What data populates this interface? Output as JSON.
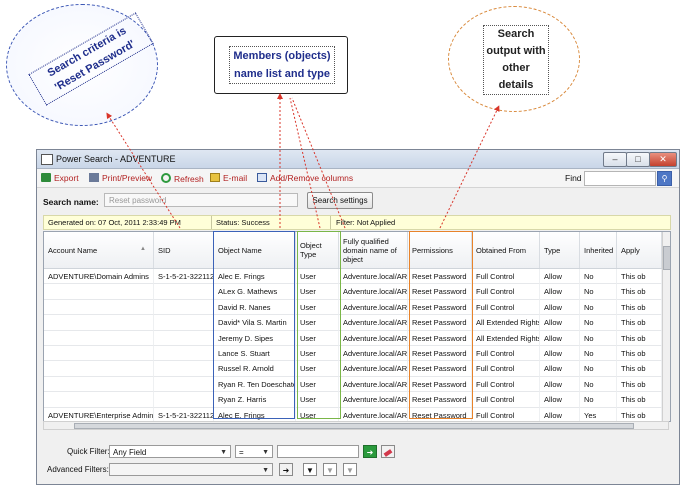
{
  "callouts": {
    "search_criteria": "Search criteria is 'Reset Password'",
    "members": "Members (objects) name list and type",
    "search_output": "Search output with other details"
  },
  "window": {
    "title": "Power Search - ADVENTURE",
    "buttons": {
      "minimize": "–",
      "maximize": "□",
      "close": "✕"
    }
  },
  "toolbar": {
    "export": "Export",
    "print": "Print/Preview",
    "refresh": "Refresh",
    "email": "E-mail",
    "columns": "Add/Remove columns",
    "find_label": "Find",
    "find_value": ""
  },
  "search": {
    "label": "Search name:",
    "placeholder": "Reset password",
    "settings_button": "Search settings"
  },
  "status": {
    "generated": "Generated on: 07 Oct, 2011 2:33:49 PM",
    "status": "Status: Success",
    "filter": "Filter: Not Applied"
  },
  "columns": [
    "Account Name",
    "SID",
    "Object Name",
    "Object Type",
    "Fully qualified domain name of object",
    "Permissions",
    "Obtained From",
    "Type",
    "Inherited",
    "Apply"
  ],
  "rows": [
    [
      "ADVENTURE\\Domain Admins",
      "S-1-5-21-322112",
      "Alec E. Frings",
      "User",
      "Adventure.local/AR",
      "Reset Password",
      "Full Control",
      "Allow",
      "No",
      "This ob"
    ],
    [
      "",
      "",
      "ALex G. Mathews",
      "User",
      "Adventure.local/AR",
      "Reset Password",
      "Full Control",
      "Allow",
      "No",
      "This ob"
    ],
    [
      "",
      "",
      "David R. Nanes",
      "User",
      "Adventure.local/AR",
      "Reset Password",
      "Full Control",
      "Allow",
      "No",
      "This ob"
    ],
    [
      "",
      "",
      "David* Vila S. Martin",
      "User",
      "Adventure.local/AR",
      "Reset Password",
      "All Extended Rights",
      "Allow",
      "No",
      "This ob"
    ],
    [
      "",
      "",
      "Jeremy D. Sipes",
      "User",
      "Adventure.local/AR",
      "Reset Password",
      "All Extended Rights",
      "Allow",
      "No",
      "This ob"
    ],
    [
      "",
      "",
      "Lance S. Stuart",
      "User",
      "Adventure.local/AR",
      "Reset Password",
      "Full Control",
      "Allow",
      "No",
      "This ob"
    ],
    [
      "",
      "",
      "Russel R. Arnold",
      "User",
      "Adventure.local/AR",
      "Reset Password",
      "Full Control",
      "Allow",
      "No",
      "This ob"
    ],
    [
      "",
      "",
      "Ryan R. Ten Doeschate",
      "User",
      "Adventure.local/AR",
      "Reset Password",
      "Full Control",
      "Allow",
      "No",
      "This ob"
    ],
    [
      "",
      "",
      "Ryan Z. Harris",
      "User",
      "Adventure.local/AR",
      "Reset Password",
      "Full Control",
      "Allow",
      "No",
      "This ob"
    ],
    [
      "ADVENTURE\\Enterprise Admins",
      "S-1-5-21-322112",
      "Alec E. Frings",
      "User",
      "Adventure.local/AR",
      "Reset Password",
      "Full Control",
      "Allow",
      "Yes",
      "This ob"
    ]
  ],
  "filters": {
    "quick_label": "Quick Filter:",
    "quick_field": "Any Field",
    "quick_op": "=",
    "quick_value": "",
    "advanced_label": "Advanced Filters:",
    "advanced_value": ""
  },
  "icons": [
    "export-icon",
    "printer-icon",
    "refresh-icon",
    "email-icon",
    "columns-icon",
    "search-icon",
    "apply-arrow-icon",
    "eraser-icon",
    "filter-icon"
  ],
  "colors": {
    "object_box": "#3b62b8",
    "type_box": "#7ab648",
    "permissions_box": "#e8832a",
    "status_bg": "#ffffd8",
    "arrow": "#d9352a"
  }
}
